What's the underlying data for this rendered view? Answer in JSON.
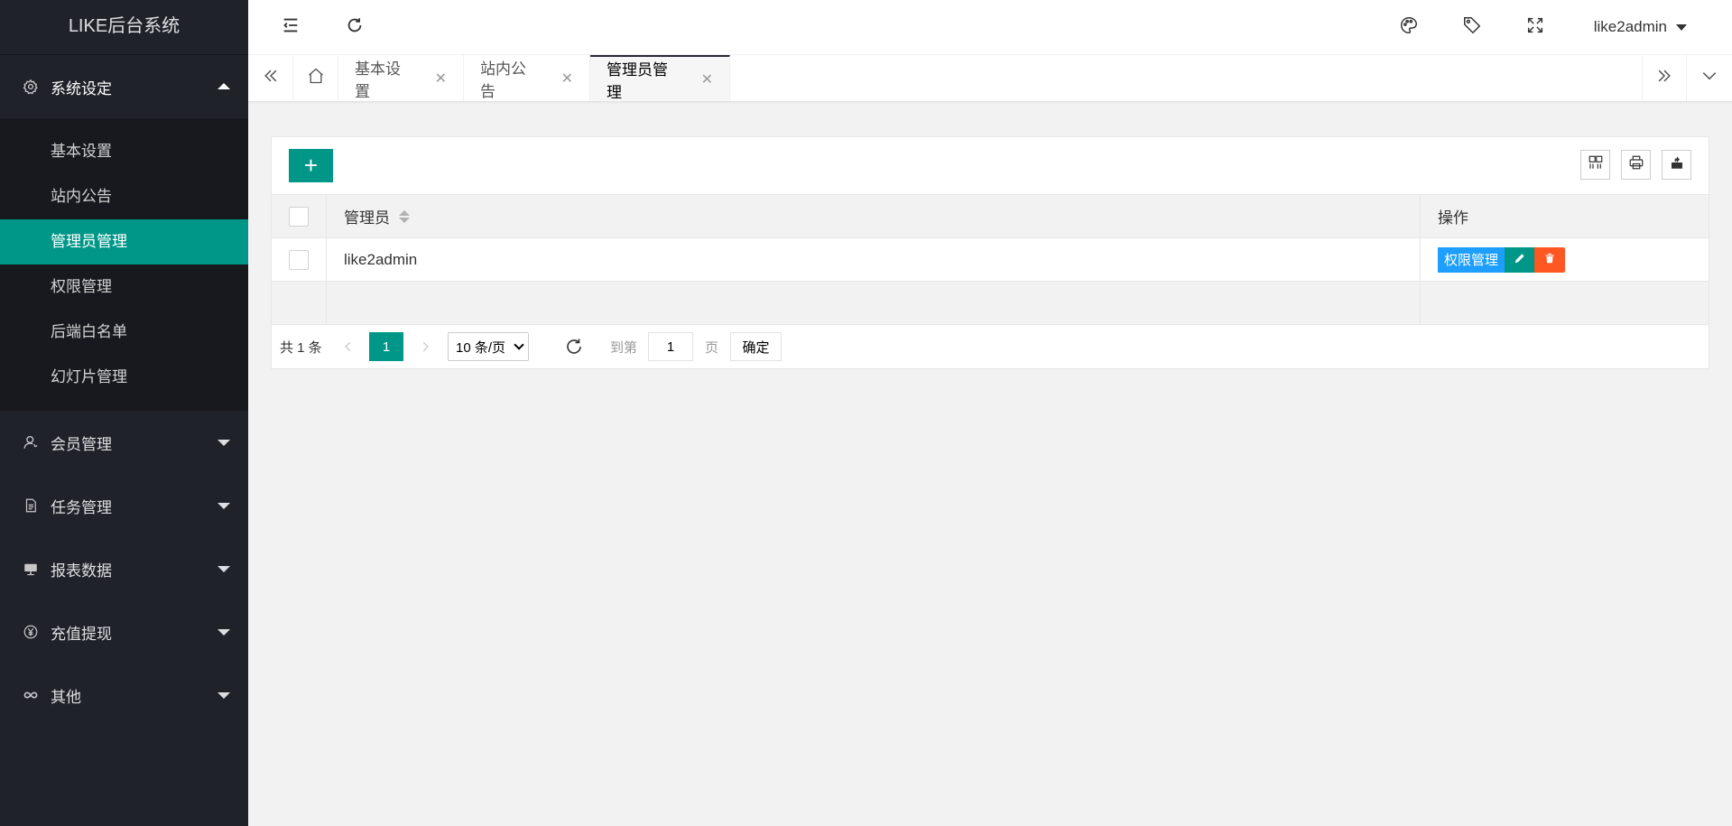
{
  "app": {
    "logo": "LIKE后台系统"
  },
  "sidebar": {
    "groups": [
      {
        "label": "系统设定",
        "icon": "gear-icon",
        "open": true,
        "items": [
          {
            "label": "基本设置"
          },
          {
            "label": "站内公告"
          },
          {
            "label": "管理员管理",
            "active": true
          },
          {
            "label": "权限管理"
          },
          {
            "label": "后端白名单"
          },
          {
            "label": "幻灯片管理"
          }
        ]
      },
      {
        "label": "会员管理",
        "icon": "user-icon"
      },
      {
        "label": "任务管理",
        "icon": "document-icon"
      },
      {
        "label": "报表数据",
        "icon": "chart-icon"
      },
      {
        "label": "充值提现",
        "icon": "yen-icon"
      },
      {
        "label": "其他",
        "icon": "infinity-icon"
      }
    ]
  },
  "header": {
    "user": "like2admin",
    "icons": [
      "menu-fold-icon",
      "refresh-icon",
      "palette-icon",
      "tag-icon",
      "fullscreen-icon"
    ]
  },
  "tabs": [
    {
      "label": "基本设置"
    },
    {
      "label": "站内公告"
    },
    {
      "label": "管理员管理",
      "active": true
    }
  ],
  "table": {
    "columns": {
      "name": "管理员",
      "op": "操作"
    },
    "rows": [
      {
        "name": "like2admin"
      }
    ],
    "actions": {
      "auth": "权限管理"
    }
  },
  "pager": {
    "count": "共 1 条",
    "current": "1",
    "size": "10 条/页",
    "goto": "到第",
    "input": "1",
    "page": "页",
    "ok": "确定"
  },
  "colors": {
    "accent": "#009688",
    "sidebar": "#20222a",
    "blue": "#1e9fff",
    "danger": "#ff5722"
  }
}
